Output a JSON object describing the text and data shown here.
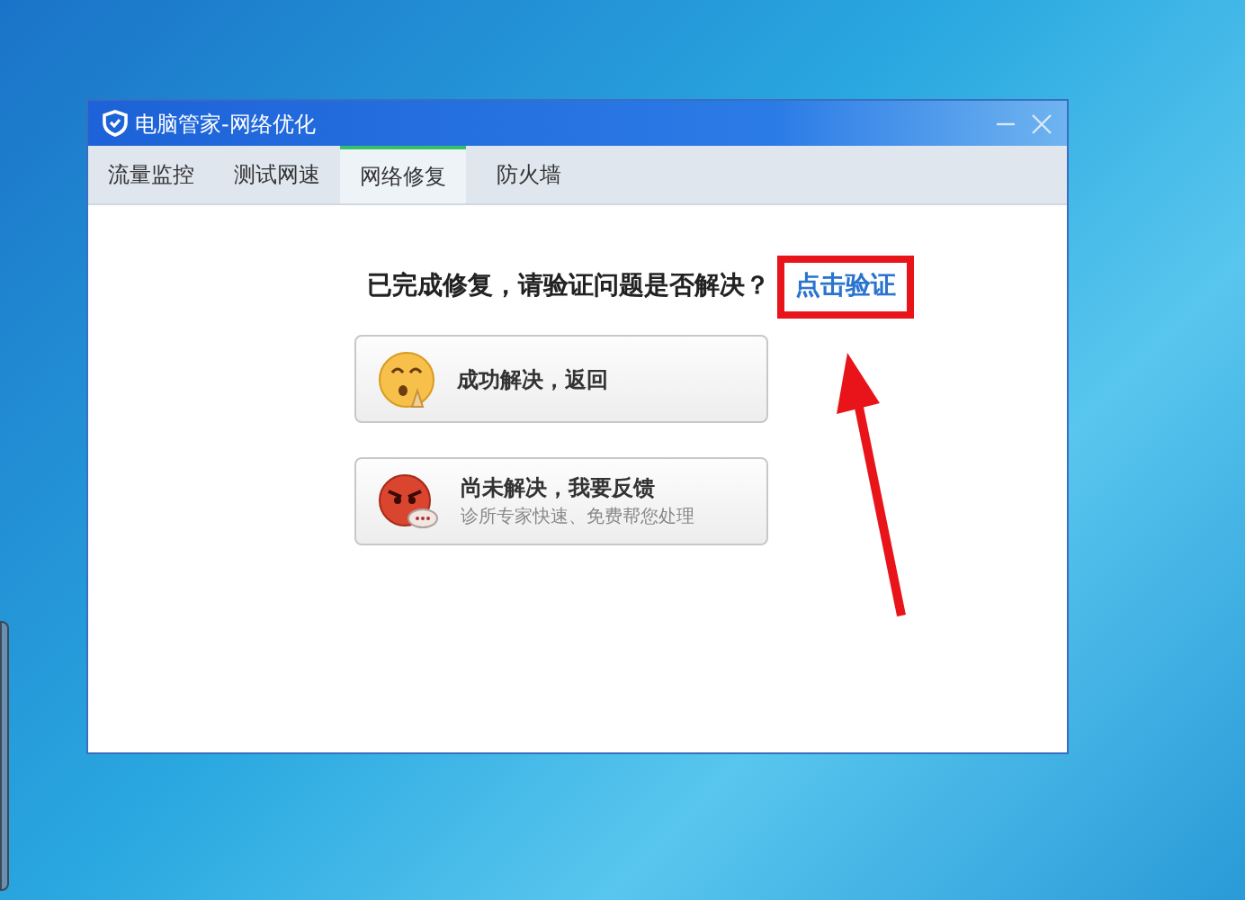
{
  "window": {
    "title": "电脑管家-网络优化"
  },
  "tabs": [
    {
      "label": "流量监控",
      "selected": false
    },
    {
      "label": "测试网速",
      "selected": false
    },
    {
      "label": "网络修复",
      "selected": true
    },
    {
      "label": "防火墙",
      "selected": false
    }
  ],
  "prompt": {
    "text": "已完成修复，请验证问题是否解决？",
    "link": "点击验证"
  },
  "options": [
    {
      "kind": "happy",
      "title": "成功解决，返回"
    },
    {
      "kind": "angry",
      "title": "尚未解决，我要反馈",
      "subtitle": "诊所专家快速、免费帮您处理"
    }
  ]
}
